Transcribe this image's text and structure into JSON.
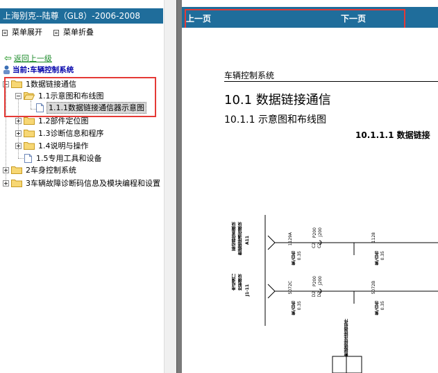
{
  "left_panel": {
    "title": "上海别克--陆尊（GL8）-2006-2008",
    "expand_label": "菜单展开",
    "collapse_label": "菜单折叠",
    "back_label": "返回上一级",
    "current_label": "当前:车辆控制系统",
    "tree": {
      "n1": "1数据链接通信",
      "n1_1": "1.1示意图和布线图",
      "n1_1_1": "1.1.1数据链接通信器示意图",
      "n1_2": "1.2部件定位图",
      "n1_3": "1.3诊断信息和程序",
      "n1_4": "1.4说明与操作",
      "n1_5": "1.5专用工具和设备",
      "n2": "2车身控制系统",
      "n3": "3车辆故障诊断码信息及模块编程和设置"
    }
  },
  "right_panel": {
    "prev_label": "上一页",
    "next_label": "下一页",
    "document": {
      "section_header": "车辆控制系统",
      "h1": "10.1 数据链接通信",
      "h2": "10.1.1 示意图和布线图",
      "h3": "10.1.1.1 数据链接"
    },
    "diagram": {
      "module1_name": "驱动器信息模块",
      "module1_sub": "数据链接通信模块",
      "module1_id": "A11",
      "module2_name": "电动滑门",
      "module2_sub": "控制模块",
      "module2_id": "J1-11",
      "wire1": "1129A",
      "wire2": "5072C",
      "wire3": "1128",
      "wire4": "5072B",
      "conn1_a": "C2",
      "conn1_b": "C2",
      "conn1_p": "P200",
      "conn1_j": "J200",
      "conn2_a": "D2",
      "conn2_b": "D2",
      "conn2_p": "P200",
      "conn2_j": "J200",
      "color1": "紫/白色",
      "color1_size": "0.35",
      "color2": "紫/白色",
      "color2_size": "0.35",
      "color3": "紫/白色",
      "color3_size": "0.35",
      "color4": "紫/白色",
      "color4_size": "0.35",
      "bottom_label": "数据链接连接器组件"
    }
  },
  "colors": {
    "title_bar": "#1f6d9b",
    "highlight_red": "#e53935",
    "link_green": "#1b8a2a",
    "current_blue": "#0000aa"
  }
}
